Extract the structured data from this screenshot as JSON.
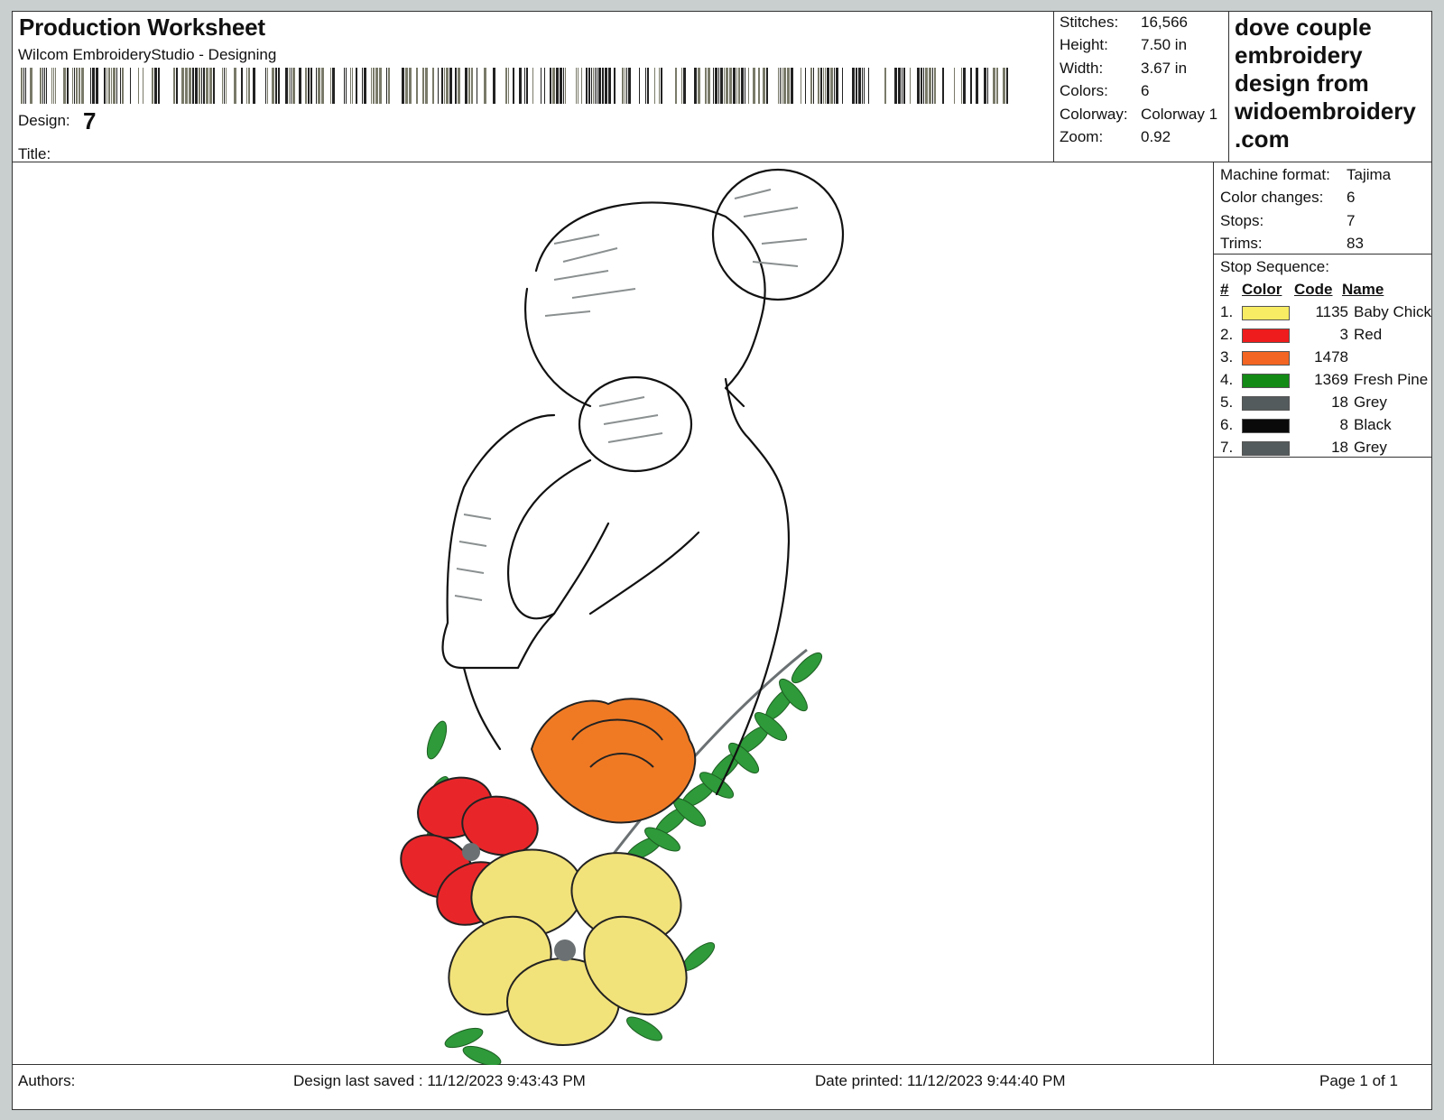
{
  "header": {
    "title": "Production Worksheet",
    "software": "Wilcom EmbroideryStudio - Designing",
    "design_label": "Design:",
    "design_value": "7",
    "title_label": "Title:"
  },
  "stats": [
    {
      "label": "Stitches:",
      "value": "16,566"
    },
    {
      "label": "Height:",
      "value": "7.50 in"
    },
    {
      "label": "Width:",
      "value": "3.67 in"
    },
    {
      "label": "Colors:",
      "value": "6"
    },
    {
      "label": "Colorway:",
      "value": "Colorway 1"
    },
    {
      "label": "Zoom:",
      "value": "0.92"
    }
  ],
  "promo": {
    "lines": [
      "dove couple",
      "embroidery",
      "design from",
      "widoembroidery",
      ".com"
    ]
  },
  "machine": [
    {
      "label": "Machine format:",
      "value": "Tajima"
    },
    {
      "label": "Color changes:",
      "value": "6"
    },
    {
      "label": "Stops:",
      "value": "7"
    },
    {
      "label": "Trims:",
      "value": "83"
    }
  ],
  "stop_sequence": {
    "heading": "Stop Sequence:",
    "columns": {
      "num": "#",
      "color": "Color",
      "code": "Code",
      "name": "Name"
    },
    "rows": [
      {
        "num": "1.",
        "color": "#f7ec63",
        "code": "1135",
        "name": "Baby Chick"
      },
      {
        "num": "2.",
        "color": "#ee1c1c",
        "code": "3",
        "name": "Red"
      },
      {
        "num": "3.",
        "color": "#f26522",
        "code": "1478",
        "name": ""
      },
      {
        "num": "4.",
        "color": "#138a16",
        "code": "1369",
        "name": "Fresh Pine"
      },
      {
        "num": "5.",
        "color": "#545b5c",
        "code": "18",
        "name": "Grey"
      },
      {
        "num": "6.",
        "color": "#0a0a0a",
        "code": "8",
        "name": "Black"
      },
      {
        "num": "7.",
        "color": "#545b5c",
        "code": "18",
        "name": "Grey"
      }
    ]
  },
  "footer": {
    "authors": "Authors:",
    "saved": "Design last saved : 11/12/2023 9:43:43 PM",
    "printed": "Date printed: 11/12/2023 9:44:40 PM",
    "page": "Page 1 of 1"
  },
  "artwork": {
    "colors": {
      "outline": "#111111",
      "hatch": "#8a8f90",
      "yellow": "#f2e27a",
      "red": "#e8262a",
      "orange": "#f07a24",
      "leaf": "#2e9a3a",
      "grey": "#6b7173"
    }
  }
}
